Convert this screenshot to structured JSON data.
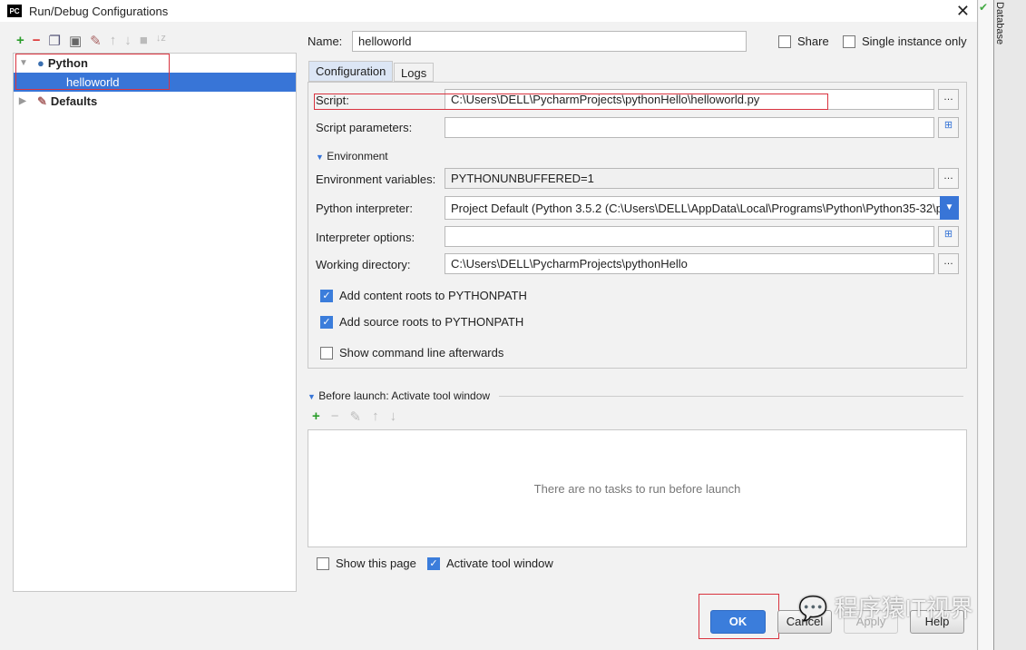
{
  "window": {
    "title": "Run/Debug Configurations",
    "logo": "PC"
  },
  "toolbar": {
    "icons": [
      "plus-icon",
      "minus-icon",
      "copy-icon",
      "save-icon",
      "wrench-icon",
      "arrow-up-icon",
      "arrow-down-icon",
      "folder-icon",
      "sort-icon"
    ]
  },
  "tree": {
    "items": [
      {
        "label": "Python"
      },
      {
        "label": "helloworld"
      },
      {
        "label": "Defaults"
      }
    ]
  },
  "name": {
    "label": "Name:",
    "value": "helloworld"
  },
  "share": {
    "label": "Share",
    "checked": false
  },
  "single": {
    "label": "Single instance only",
    "checked": false
  },
  "tabs": [
    {
      "label": "Configuration",
      "active": true
    },
    {
      "label": "Logs"
    }
  ],
  "form": {
    "script": {
      "label": "Script:",
      "value": "C:\\Users\\DELL\\PycharmProjects\\pythonHello\\helloworld.py"
    },
    "params": {
      "label": "Script parameters:",
      "value": ""
    },
    "env_header": "Environment",
    "env_vars": {
      "label": "Environment variables:",
      "value": "PYTHONUNBUFFERED=1"
    },
    "interpreter": {
      "label": "Python interpreter:",
      "value": "Project Default (Python 3.5.2 (C:\\Users\\DELL\\AppData\\Local\\Programs\\Python\\Python35-32\\p"
    },
    "interp_opts": {
      "label": "Interpreter options:",
      "value": ""
    },
    "workdir": {
      "label": "Working directory:",
      "value": "C:\\Users\\DELL\\PycharmProjects\\pythonHello"
    },
    "content_roots": {
      "label": "Add content roots to PYTHONPATH",
      "checked": true
    },
    "source_roots": {
      "label": "Add source roots to PYTHONPATH",
      "checked": true
    },
    "show_cmd": {
      "label": "Show command line afterwards",
      "checked": false
    }
  },
  "before_launch": {
    "header": "Before launch: Activate tool window",
    "empty": "There are no tasks to run before launch"
  },
  "show_page": {
    "label": "Show this page",
    "checked": false
  },
  "activate": {
    "label": "Activate tool window",
    "checked": true
  },
  "buttons": {
    "ok": "OK",
    "cancel": "Cancel",
    "apply": "Apply",
    "help": "Help"
  },
  "side": {
    "database": "Database"
  },
  "watermark": "程序猿IT视界",
  "colors": {
    "accent": "#3875d7",
    "highlight": "#d9333f"
  }
}
